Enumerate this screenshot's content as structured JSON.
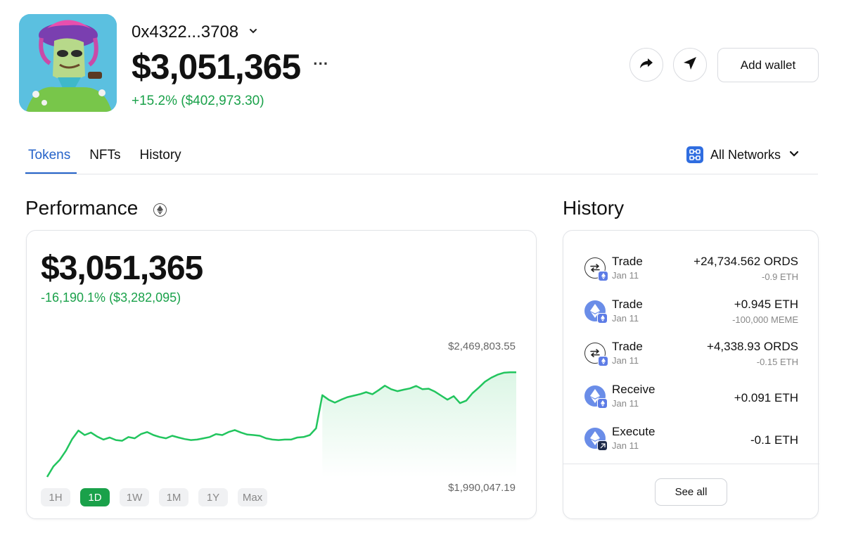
{
  "wallet": {
    "address": "0x4322...3708",
    "balance": "$3,051,365",
    "change": "+15.2% ($402,973.30)",
    "more_label": "···"
  },
  "actions": {
    "add_wallet_label": "Add wallet",
    "share_icon": "share-icon",
    "send_icon": "send-icon"
  },
  "tabs": [
    {
      "label": "Tokens",
      "active": true
    },
    {
      "label": "NFTs",
      "active": false
    },
    {
      "label": "History",
      "active": false
    }
  ],
  "network_filter": {
    "label": "All Networks",
    "icon": "networks-icon"
  },
  "performance": {
    "title": "Performance",
    "value": "$3,051,365",
    "change": "-16,190.1% ($3,282,095)",
    "max_label": "$2,469,803.55",
    "min_label": "$1,990,047.19",
    "ranges": [
      {
        "label": "1H",
        "active": false
      },
      {
        "label": "1D",
        "active": true
      },
      {
        "label": "1W",
        "active": false
      },
      {
        "label": "1M",
        "active": false
      },
      {
        "label": "1Y",
        "active": false
      },
      {
        "label": "Max",
        "active": false
      }
    ],
    "line_color": "#22c55e"
  },
  "chart_data": {
    "type": "area",
    "title": "",
    "xlabel": "",
    "ylabel": "",
    "ylim": [
      1990047.19,
      2469803.55
    ],
    "series": [
      {
        "values": [
          1990047,
          2032000,
          2058000,
          2095000,
          2142000,
          2176000,
          2158000,
          2168000,
          2152000,
          2140000,
          2148000,
          2138000,
          2135000,
          2150000,
          2145000,
          2162000,
          2170000,
          2158000,
          2150000,
          2145000,
          2155000,
          2148000,
          2142000,
          2138000,
          2140000,
          2145000,
          2150000,
          2162000,
          2158000,
          2170000,
          2178000,
          2168000,
          2160000,
          2158000,
          2155000,
          2145000,
          2140000,
          2138000,
          2140000,
          2140000,
          2148000,
          2150000,
          2158000,
          2185000,
          2318000,
          2300000,
          2288000,
          2300000,
          2310000,
          2316000,
          2322000,
          2330000,
          2322000,
          2338000,
          2356000,
          2342000,
          2334000,
          2340000,
          2345000,
          2355000,
          2342000,
          2344000,
          2332000,
          2316000,
          2300000,
          2314000,
          2286000,
          2296000,
          2326000,
          2348000,
          2372000,
          2388000,
          2400000,
          2408000,
          2410000,
          2410000
        ]
      }
    ]
  },
  "history": {
    "title": "History",
    "items": [
      {
        "type": "Trade",
        "date": "Jan 11",
        "amount": "+24,734.562 ORDS",
        "sub": "-0.9 ETH",
        "icon": "trade-icon",
        "badge": "ethereum-badge-icon"
      },
      {
        "type": "Trade",
        "date": "Jan 11",
        "amount": "+0.945 ETH",
        "sub": "-100,000 MEME",
        "icon": "eth-token-icon",
        "badge": "ethereum-badge-icon"
      },
      {
        "type": "Trade",
        "date": "Jan 11",
        "amount": "+4,338.93 ORDS",
        "sub": "-0.15 ETH",
        "icon": "trade-icon",
        "badge": "ethereum-badge-icon"
      },
      {
        "type": "Receive",
        "date": "Jan 11",
        "amount": "+0.091 ETH",
        "sub": "",
        "icon": "eth-token-icon",
        "badge": "ethereum-badge-icon"
      },
      {
        "type": "Execute",
        "date": "Jan 11",
        "amount": "-0.1 ETH",
        "sub": "",
        "icon": "eth-token-icon",
        "badge": "contract-badge-icon"
      }
    ],
    "see_all_label": "See all"
  }
}
